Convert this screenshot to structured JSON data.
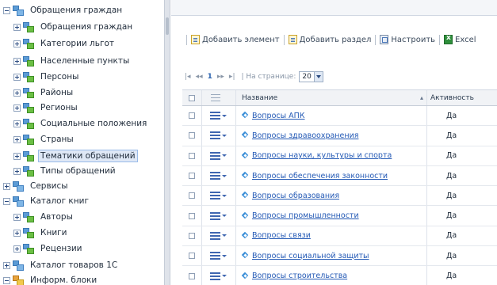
{
  "tree": {
    "nodes": [
      {
        "label": "Обращения граждан",
        "expander": "minus",
        "icon": "folder",
        "level": 0
      },
      {
        "label": "Обращения граждан",
        "expander": "plus",
        "icon": "dict",
        "level": 1
      },
      {
        "label": "Категории льгот",
        "expander": "plus",
        "icon": "dict",
        "level": 1
      },
      {
        "label": "Населенные пункты",
        "expander": "plus",
        "icon": "dict",
        "level": 1
      },
      {
        "label": "Персоны",
        "expander": "plus",
        "icon": "dict",
        "level": 1
      },
      {
        "label": "Районы",
        "expander": "plus",
        "icon": "dict",
        "level": 1
      },
      {
        "label": "Регионы",
        "expander": "plus",
        "icon": "dict",
        "level": 1
      },
      {
        "label": "Социальные положения",
        "expander": "plus",
        "icon": "dict",
        "level": 1
      },
      {
        "label": "Страны",
        "expander": "plus",
        "icon": "dict",
        "level": 1
      },
      {
        "label": "Тематики обращений",
        "expander": "plus",
        "icon": "dict",
        "level": 1,
        "selected": true
      },
      {
        "label": "Типы обращений",
        "expander": "plus",
        "icon": "dict",
        "level": 1
      },
      {
        "label": "Сервисы",
        "expander": "plus",
        "icon": "folder",
        "level": 0
      },
      {
        "label": "Каталог книг",
        "expander": "minus",
        "icon": "folder",
        "level": 0
      },
      {
        "label": "Авторы",
        "expander": "plus",
        "icon": "dict",
        "level": 1
      },
      {
        "label": "Книги",
        "expander": "plus",
        "icon": "dict",
        "level": 1
      },
      {
        "label": "Рецензии",
        "expander": "plus",
        "icon": "dict",
        "level": 1
      },
      {
        "label": "Каталог товаров 1С",
        "expander": "plus",
        "icon": "folder",
        "level": 0
      },
      {
        "label": "Информ. блоки",
        "expander": "minus",
        "icon": "info",
        "level": 0
      }
    ]
  },
  "toolbar": {
    "buttons": [
      {
        "label": "Добавить элемент",
        "icon": "add-element-icon"
      },
      {
        "label": "Добавить раздел",
        "icon": "add-section-icon"
      },
      {
        "label": "Настроить",
        "icon": "settings-icon"
      },
      {
        "label": "Excel",
        "icon": "excel-icon"
      }
    ]
  },
  "pager": {
    "first": "|◂",
    "prev": "◂◂",
    "current_page": "1",
    "next": "▸▸",
    "last": "▸|",
    "per_page_label": "| На странице:",
    "per_page_value": "20"
  },
  "grid": {
    "columns": {
      "name": "Название",
      "active": "Активность"
    },
    "sort_indicator": "▴",
    "rows": [
      {
        "name": "Вопросы АПК",
        "active": "Да"
      },
      {
        "name": "Вопросы здравоохранения",
        "active": "Да"
      },
      {
        "name": "Вопросы науки, культуры и спорта",
        "active": "Да"
      },
      {
        "name": "Вопросы обеспечения законности",
        "active": "Да"
      },
      {
        "name": "Вопросы образования",
        "active": "Да"
      },
      {
        "name": "Вопросы промышленности",
        "active": "Да"
      },
      {
        "name": "Вопросы связи",
        "active": "Да"
      },
      {
        "name": "Вопросы социальной защиты",
        "active": "Да"
      },
      {
        "name": "Вопросы строительства",
        "active": "Да"
      }
    ]
  }
}
